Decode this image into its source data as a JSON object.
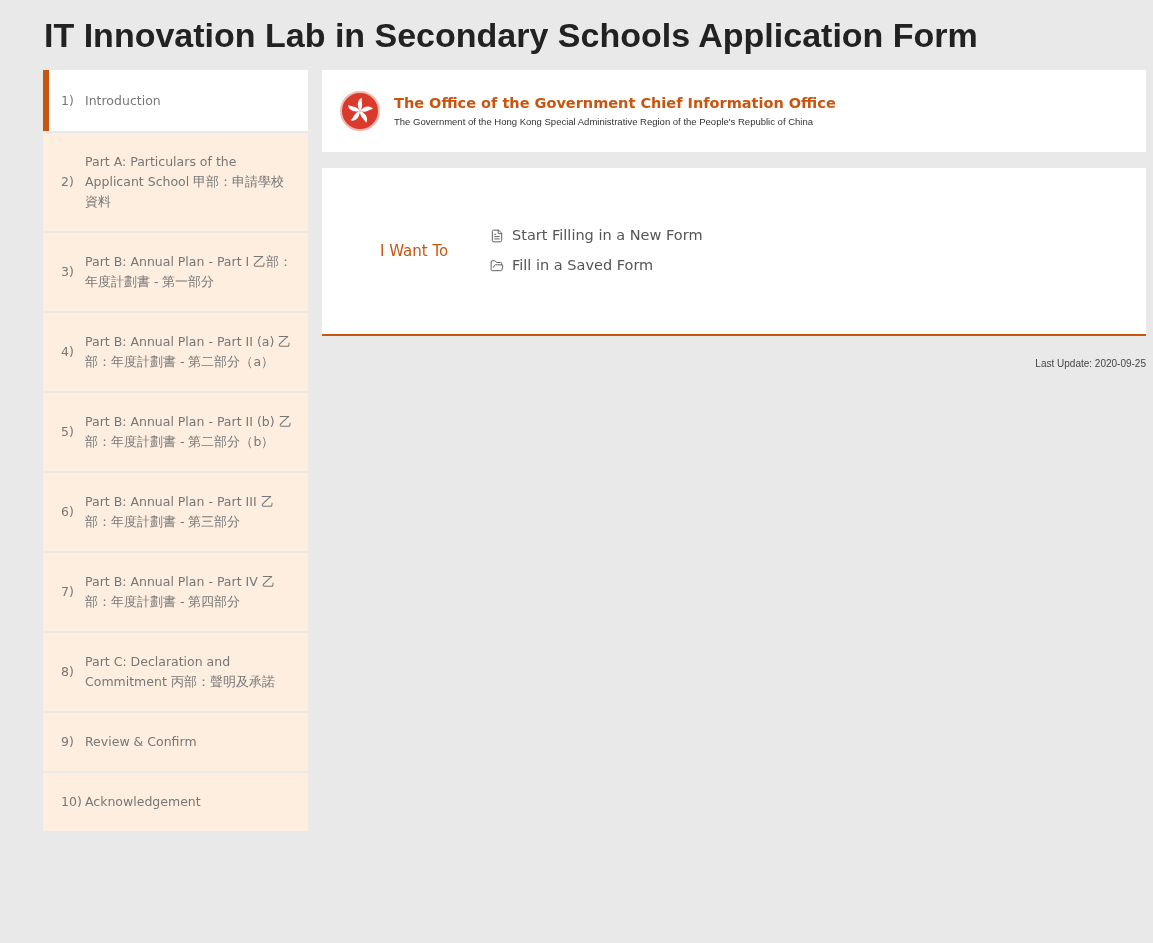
{
  "title": "IT Innovation Lab in Secondary Schools Application Form",
  "sidebar": {
    "items": [
      {
        "number": "1)",
        "label": "Introduction",
        "selected": true
      },
      {
        "number": "2)",
        "label": "Part A: Particulars of the Applicant School 甲部：申請學校資料",
        "selected": false
      },
      {
        "number": "3)",
        "label": "Part B: Annual Plan - Part I 乙部：年度計劃書 - 第一部分",
        "selected": false
      },
      {
        "number": "4)",
        "label": "Part B: Annual Plan - Part II (a) 乙部：年度計劃書 - 第二部分（a）",
        "selected": false
      },
      {
        "number": "5)",
        "label": "Part B: Annual Plan - Part II (b) 乙部：年度計劃書 - 第二部分（b）",
        "selected": false
      },
      {
        "number": "6)",
        "label": "Part B: Annual Plan - Part III 乙部：年度計劃書 - 第三部分",
        "selected": false
      },
      {
        "number": "7)",
        "label": "Part B: Annual Plan - Part IV 乙部：年度計劃書 - 第四部分",
        "selected": false
      },
      {
        "number": "8)",
        "label": "Part C: Declaration and Commitment 丙部：聲明及承諾",
        "selected": false
      },
      {
        "number": "9)",
        "label": "Review & Confirm",
        "selected": false
      },
      {
        "number": "10)",
        "label": "Acknowledgement",
        "selected": false
      }
    ]
  },
  "header": {
    "office": "The Office of the Government Chief Information Office",
    "government": "The Government of the Hong Kong Special Administrative Region of the People's Republic of China"
  },
  "options": {
    "label": "I Want To",
    "links": [
      {
        "kind": "new",
        "text": "Start Filling in a New Form"
      },
      {
        "kind": "saved",
        "text": "Fill in a Saved Form"
      }
    ]
  },
  "last_update": "Last Update: 2020-09-25"
}
